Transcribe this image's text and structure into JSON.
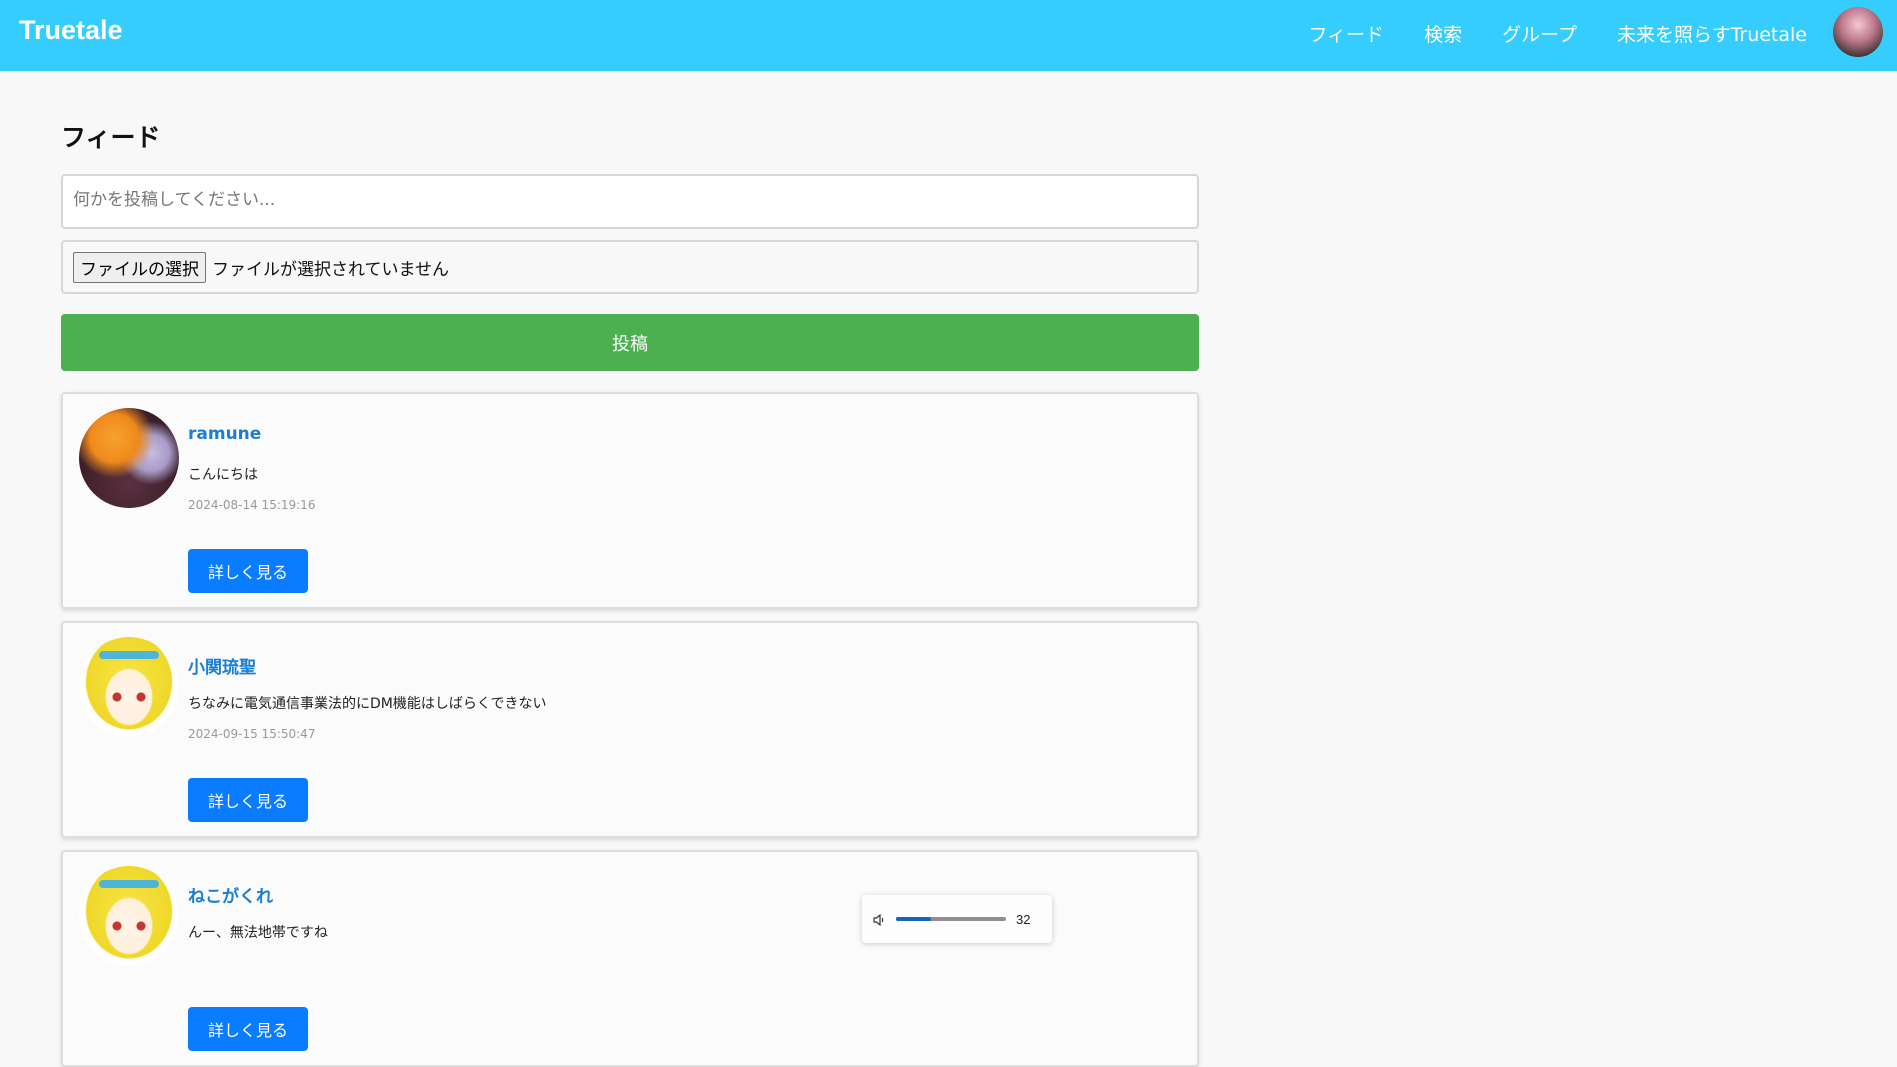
{
  "app": {
    "brand": "Truetale"
  },
  "nav": {
    "items": [
      {
        "label": "フィード"
      },
      {
        "label": "検索"
      },
      {
        "label": "グループ"
      },
      {
        "label": "未来を照らすTruetale"
      }
    ]
  },
  "page": {
    "title": "フィード"
  },
  "composer": {
    "placeholder": "何かを投稿してください...",
    "value": "",
    "file_button": "ファイルの選択",
    "file_status": "ファイルが選択されていません",
    "submit_label": "投稿"
  },
  "posts": [
    {
      "username": "ramune",
      "text": "こんにちは",
      "timestamp": "2024-08-14 15:19:16",
      "detail_label": "詳しく見る"
    },
    {
      "username": "小関琉聖",
      "text": "ちなみに電気通信事業法的にDM機能はしばらくできない",
      "timestamp": "2024-09-15 15:50:47",
      "detail_label": "詳しく見る"
    },
    {
      "username": "ねこがくれ",
      "text": "んー、無法地帯ですね",
      "timestamp": "",
      "detail_label": "詳しく見る"
    }
  ],
  "audio": {
    "volume": 32,
    "volume_label": "32"
  },
  "colors": {
    "navbar": "#35cdfe",
    "submit": "#4caf50",
    "detail_button": "#0a7cff",
    "username": "#1a7fd4"
  },
  "icons": {
    "speaker": "speaker-icon"
  }
}
